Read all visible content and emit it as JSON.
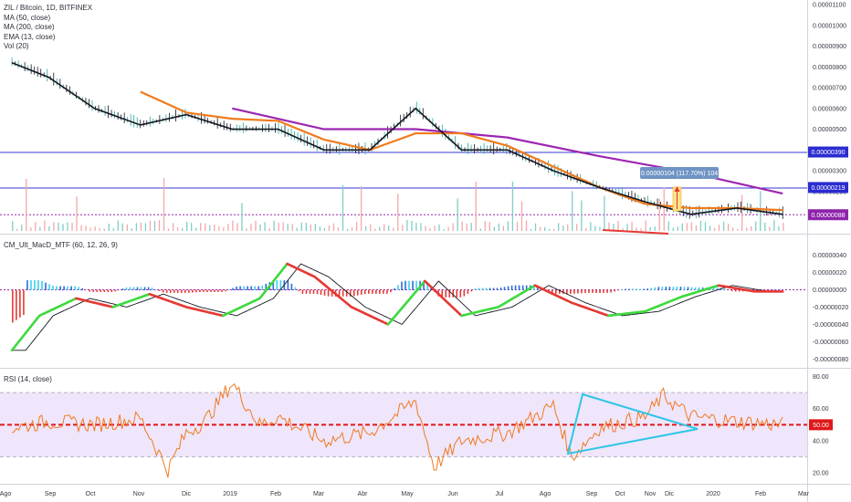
{
  "colors": {
    "ma50": "#f07b1c",
    "ma200": "#9c27b0",
    "ema13": "#131722",
    "hline": "#3a3ad6",
    "rsi_line": "#ef7a22",
    "rsi_band": "#efe6fb",
    "rsi_mid": "#e0181b",
    "macd_green": "#3fd93f",
    "macd_red": "#e53935",
    "macd_blue": "#2f6bd8",
    "macd_cyan": "#3ad0ee",
    "triangle": "#2ec6e6",
    "arrow": "#e53935",
    "measure_tag": "#6f93c4"
  },
  "legend": {
    "symbol": "ZIL / Bitcoin, 1D, BITFINEX",
    "ma50": "MA (50, close)",
    "ma200": "MA (200, close)",
    "ema13": "EMA (13, close)",
    "vol": "Vol (20)",
    "macd": "CM_Ult_MacD_MTF (60, 12, 26, 9)",
    "rsi": "RSI (14, close)"
  },
  "chart_data": [
    {
      "type": "line",
      "title": "ZIL / Bitcoin, 1D, BITFINEX",
      "xlabel": "",
      "ylabel": "",
      "x_ticks": [
        "Ago",
        "Sep",
        "Oct",
        "Nov",
        "Dic",
        "2019",
        "Feb",
        "Mar",
        "Abr",
        "May",
        "Jun",
        "Jul",
        "Ago",
        "Sep",
        "Oct",
        "Nov",
        "Dic",
        "2020",
        "Feb",
        "Mar"
      ],
      "y_ticks": [
        "0.00001100",
        "0.00001000",
        "0.00000900",
        "0.00000800",
        "0.00000700",
        "0.00000600",
        "0.00000500",
        "0.00000400",
        "0.00000300",
        "0.00000200",
        "0.00000100"
      ],
      "ylim": [
        1e-07,
        1.1e-05
      ],
      "price_labels": [
        "0.00000390",
        "0.00000219",
        "0.00000088"
      ],
      "horizontal_levels": [
        3.9e-06,
        2.19e-06
      ],
      "measure_label": "0.00000104 (117.70%) 104",
      "series": [
        {
          "name": "MA (50, close)",
          "x": [
            15,
            20,
            25,
            30,
            35,
            40,
            45,
            50,
            55,
            60,
            65,
            70,
            75,
            80,
            85
          ],
          "values": [
            6.8e-06,
            5.8e-06,
            5.5e-06,
            5.4e-06,
            4.5e-06,
            4e-06,
            4.8e-06,
            4.8e-06,
            4.2e-06,
            3.2e-06,
            2.2e-06,
            1.4e-06,
            1.2e-06,
            1.2e-06,
            1.1e-06
          ]
        },
        {
          "name": "MA (200, close)",
          "x": [
            25,
            35,
            45,
            55,
            65,
            75,
            85
          ],
          "values": [
            6e-06,
            5e-06,
            5e-06,
            4.6e-06,
            3.7e-06,
            2.9e-06,
            1.9e-06
          ]
        },
        {
          "name": "EMA (13, close)",
          "x": [
            1,
            5,
            10,
            15,
            20,
            25,
            30,
            35,
            40,
            45,
            50,
            55,
            60,
            65,
            70,
            75,
            80,
            85
          ],
          "values": [
            8.2e-06,
            7.5e-06,
            6e-06,
            5.2e-06,
            5.7e-06,
            5e-06,
            5e-06,
            4e-06,
            4e-06,
            6e-06,
            4e-06,
            4e-06,
            3e-06,
            2.2e-06,
            1.5e-06,
            9e-07,
            1.2e-06,
            9e-07
          ]
        }
      ]
    },
    {
      "type": "bar",
      "title": "CM_Ult_MacD_MTF (60, 12, 26, 9)",
      "ylabel": "",
      "y_ticks": [
        "0.00000040",
        "0.00000020",
        "0.00000000",
        "-0.00000020",
        "-0.00000040",
        "-0.00000060",
        "-0.00000080"
      ],
      "ylim": [
        -8.5e-07,
        4.8e-07
      ],
      "series": [
        {
          "name": "MACD",
          "x": [
            1,
            4,
            8,
            12,
            16,
            20,
            24,
            28,
            31,
            34,
            38,
            42,
            46,
            50,
            54,
            58,
            62,
            66,
            70,
            74,
            78,
            82,
            86
          ],
          "values": [
            -7e-07,
            -3e-07,
            -1e-07,
            -2e-07,
            -5e-08,
            -2e-07,
            -3e-07,
            -1e-07,
            3e-07,
            1.5e-07,
            -2e-07,
            -4e-07,
            1e-07,
            -3e-07,
            -2e-07,
            5e-08,
            -1.5e-07,
            -3e-07,
            -2.5e-07,
            -8e-08,
            5e-08,
            -2e-08,
            -2e-08
          ]
        }
      ]
    },
    {
      "type": "line",
      "title": "RSI (14, close)",
      "ylabel": "",
      "y_ticks": [
        "80.00",
        "60.00",
        "40.00",
        "20.00"
      ],
      "ylim": [
        15,
        82
      ],
      "levels": [
        70,
        50,
        30
      ],
      "current_label": "50.00",
      "series": [
        {
          "name": "RSI (14, close)",
          "x": [
            1,
            5,
            10,
            15,
            18,
            20,
            22,
            25,
            28,
            30,
            35,
            40,
            45,
            47,
            50,
            55,
            60,
            62,
            65,
            70,
            72,
            75,
            80,
            85
          ],
          "values": [
            48,
            52,
            50,
            54,
            22,
            45,
            52,
            76,
            50,
            55,
            40,
            45,
            65,
            24,
            40,
            45,
            62,
            30,
            48,
            55,
            68,
            55,
            52,
            50
          ]
        }
      ]
    }
  ]
}
